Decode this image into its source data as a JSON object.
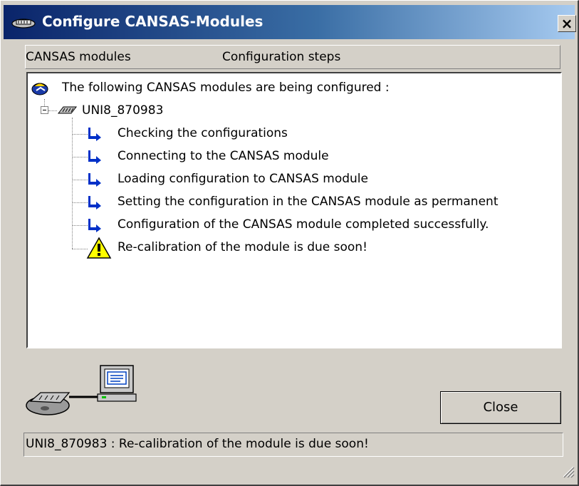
{
  "window": {
    "title": "Configure CANSAS-Modules",
    "close_glyph": "×",
    "icon": "cansas-module-icon"
  },
  "header": {
    "items": [
      "CANSAS modules",
      "Configuration steps"
    ]
  },
  "tree": {
    "root_label": "The following CANSAS modules are being configured :",
    "module": {
      "name": "UNI8_870983",
      "expanded": true,
      "steps": [
        {
          "icon": "arrow-icon",
          "label": "Checking the configurations"
        },
        {
          "icon": "arrow-icon",
          "label": "Connecting to the CANSAS module"
        },
        {
          "icon": "arrow-icon",
          "label": "Loading configuration to CANSAS module"
        },
        {
          "icon": "arrow-icon",
          "label": "Setting the configuration in the CANSAS module as permanent"
        },
        {
          "icon": "arrow-icon",
          "label": "Configuration of the CANSAS module completed successfully."
        },
        {
          "icon": "warning-icon",
          "label": "Re-calibration of the module is due soon!"
        }
      ]
    }
  },
  "buttons": {
    "close_label": "Close"
  },
  "status": {
    "text": "UNI8_870983 : Re-calibration of the module is due soon!"
  },
  "colors": {
    "titlebar_start": "#0a246a",
    "titlebar_end": "#a6caf0",
    "dialog_bg": "#d4d0c8",
    "arrow_blue": "#0030c8",
    "warning_yellow": "#ffff00"
  }
}
